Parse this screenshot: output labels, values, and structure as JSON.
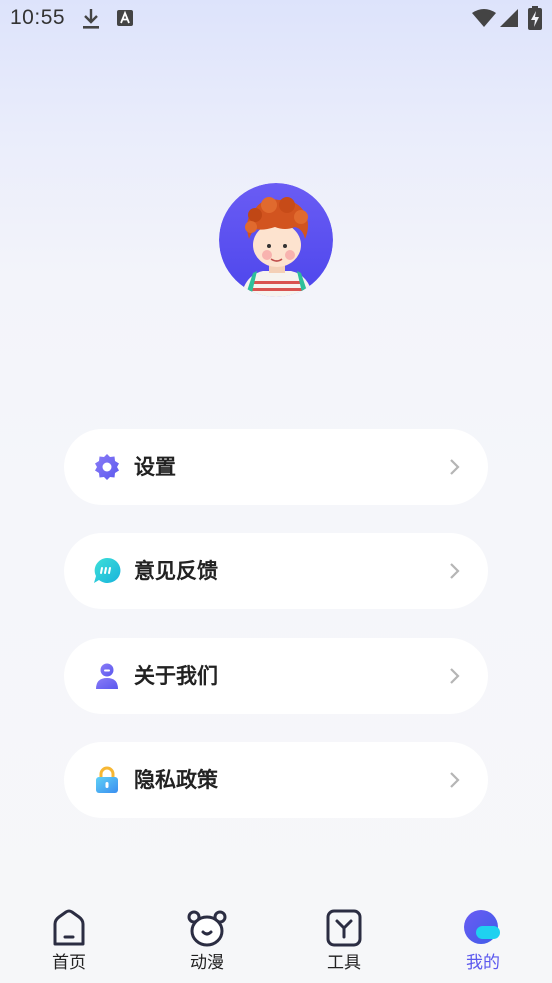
{
  "status_bar": {
    "time": "10:55"
  },
  "menu": [
    {
      "label": "设置",
      "icon": "gear-icon"
    },
    {
      "label": "意见反馈",
      "icon": "feedback-chat-icon"
    },
    {
      "label": "关于我们",
      "icon": "person-icon"
    },
    {
      "label": "隐私政策",
      "icon": "lock-icon"
    }
  ],
  "tabs": [
    {
      "label": "首页",
      "icon": "home-icon",
      "active": false
    },
    {
      "label": "动漫",
      "icon": "bear-face-icon",
      "active": false
    },
    {
      "label": "工具",
      "icon": "tools-icon",
      "active": false
    },
    {
      "label": "我的",
      "icon": "profile-blob-icon",
      "active": true
    }
  ],
  "colors": {
    "accent": "#5b58ee",
    "avatar_bg": "#5f55f0",
    "feedback": "#22c7d8",
    "lock": "#39a9f2"
  }
}
